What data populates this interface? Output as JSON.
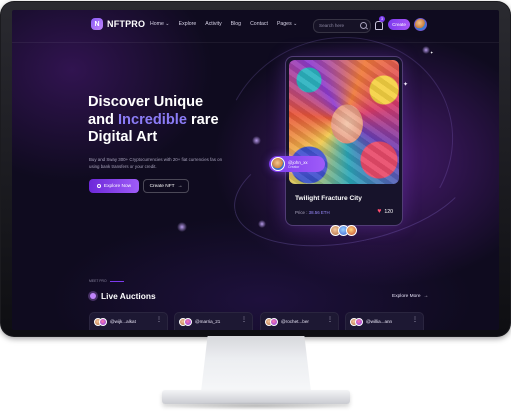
{
  "brand": {
    "name": "NFTPRO",
    "mark": "N"
  },
  "nav": [
    {
      "label": "Home",
      "has_dropdown": true
    },
    {
      "label": "Explore",
      "has_dropdown": false
    },
    {
      "label": "Activity",
      "has_dropdown": false
    },
    {
      "label": "Blog",
      "has_dropdown": false
    },
    {
      "label": "Contact",
      "has_dropdown": false
    },
    {
      "label": "Pages",
      "has_dropdown": true
    }
  ],
  "nav_labels": {
    "home": "Home ⌄",
    "explore": "Explore",
    "activity": "Activity",
    "blog": "Blog",
    "contact": "Contact",
    "pages": "Pages ⌄"
  },
  "search": {
    "placeholder": "Search here",
    "icon": "search-icon"
  },
  "notifications": {
    "count": "3",
    "icon": "bell-icon"
  },
  "header": {
    "create_label": "Create"
  },
  "hero": {
    "title_part1": "Discover Unique",
    "title_part2": "and ",
    "title_accent": "Incredible",
    "title_part3": " rare",
    "title_part4": "Digital Art",
    "subtitle": "Buy and Sway 300+ Cryptocurrencies with 20+ fiat currencies fas on using bank transfers or your credit.",
    "explore_label": "Explore Now",
    "create_label": "Create NFT",
    "create_arrow": "→"
  },
  "featured": {
    "title": "Twilight Fracture City",
    "price_label": "Price : ",
    "price_value": "38.56 ETH",
    "likes": "120",
    "heart_icon": "♥",
    "creator_name": "@john_xx",
    "creator_role": "Creator"
  },
  "auctions_section": {
    "tag": "MEET PRO",
    "title": "Live Auctions",
    "explore_more": "Explore More",
    "explore_more_arrow": "→"
  },
  "auctions": [
    {
      "user": "@wijk...alkat"
    },
    {
      "user": "@marria_21"
    },
    {
      "user": "@rochet...ber"
    },
    {
      "user": "@willia...ann"
    }
  ],
  "colors": {
    "accent": "#7c3aed",
    "accent_light": "#8b7cf6",
    "background": "#0f0b1f",
    "like": "#ff4d6d"
  }
}
